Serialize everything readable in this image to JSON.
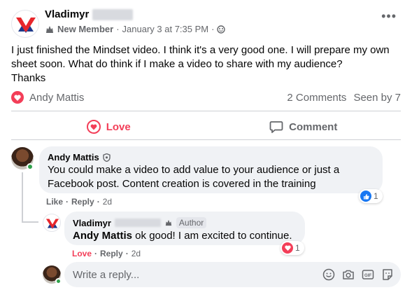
{
  "post": {
    "author": "Vladimyr",
    "role_badge": "New Member",
    "separator": "·",
    "date": "January 3 at 7:35 PM",
    "more_icon": "more-options-icon",
    "body_line1": "I just finished the Mindset video. I think it's a very good one. I will prepare my own sheet soon. What do think if I make a video to share with my audience?",
    "body_line2": "Thanks"
  },
  "reactions": {
    "reactor": "Andy Mattis",
    "comments_count": "2 Comments",
    "seen_by": "Seen by 7"
  },
  "actions": {
    "love_label": "Love",
    "comment_label": "Comment"
  },
  "comments": [
    {
      "author": "Andy Mattis",
      "text": "You could make a video to add value to your audience or just a Facebook post. Content creation is covered in the training",
      "reaction_label": "Like",
      "reply_label": "Reply",
      "time": "2d",
      "reaction_count": "1"
    }
  ],
  "reply": {
    "author": "Vladimyr",
    "author_tag": "Author",
    "mention": "Andy Mattis",
    "text": " ok good! I am excited to continue.",
    "reaction_label": "Love",
    "reply_label": "Reply",
    "time": "2d",
    "reaction_count": "1"
  },
  "composer": {
    "placeholder": "Write a reply..."
  },
  "colors": {
    "love": "#f33e58",
    "like": "#1877f2",
    "muted": "#65676b",
    "bubble": "#f0f2f5",
    "online": "#31a24c"
  }
}
